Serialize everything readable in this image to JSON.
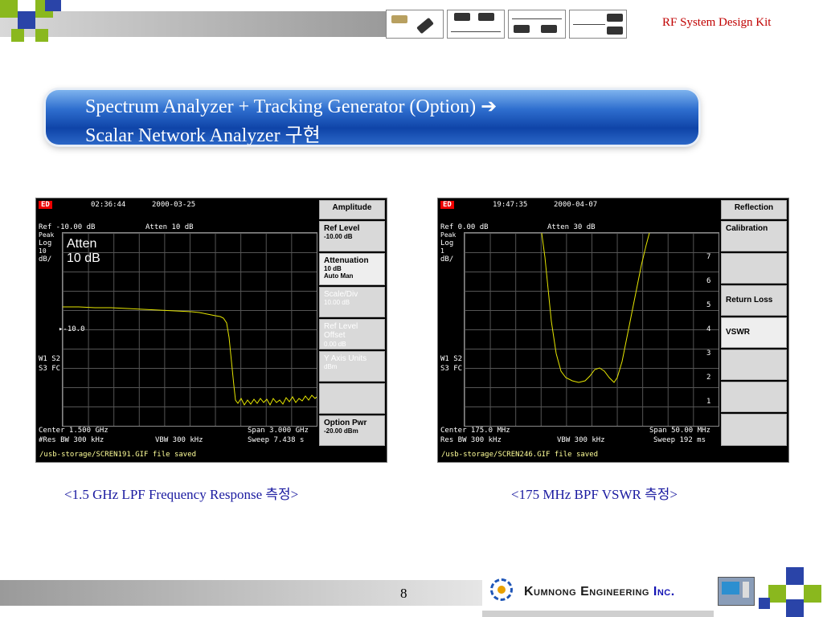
{
  "header": {
    "title": "RF System Design Kit"
  },
  "banner": {
    "line1": "Spectrum Analyzer +  Tracking Generator (Option) ➔",
    "line2": "Scalar Network Analyzer 구현"
  },
  "left_analyzer": {
    "badge": "ED",
    "time": "02:36:44",
    "date": "2000-03-25",
    "ref": "Ref -10.00 dB",
    "atten": "Atten  10 dB",
    "peak": "Peak",
    "log": "Log",
    "div_val": "10",
    "div_unit": "dB/",
    "overlay_line1": "Atten",
    "overlay_line2": "10 dB",
    "marker": "▸-10.0",
    "w1s2": "W1 S2",
    "s3fc": "S3 FC",
    "center": "Center  1.500 GHz",
    "span": "Span 3.000 GHz",
    "res_bw": "#Res BW 300 kHz",
    "vbw": "VBW  300 kHz",
    "sweep": "Sweep  7.438 s",
    "status": "/usb-storage/SCREN191.GIF file saved",
    "softkeys": [
      {
        "label": "Amplitude",
        "sub": ""
      },
      {
        "label": "Ref Level",
        "sub": "-10.00 dB"
      },
      {
        "label": "Attenuation",
        "sub": "10 dB",
        "sub2": "Auto    Man"
      },
      {
        "label": "Scale/Div",
        "sub": "10.00 dB"
      },
      {
        "label": "Ref Level Offset",
        "sub": "0.00 dB"
      },
      {
        "label": "Y Axis Units",
        "sub": "dBm"
      },
      {
        "label": "",
        "sub": ""
      },
      {
        "label": "Option Pwr",
        "sub": "-20.00 dBm"
      }
    ]
  },
  "right_analyzer": {
    "badge": "ED",
    "time": "19:47:35",
    "date": "2000-04-07",
    "ref": "Ref 0.00 dB",
    "atten": "Atten  30 dB",
    "peak": "Peak",
    "log": "Log",
    "div_val": "1",
    "div_unit": "dB/",
    "w1s2": "W1 S2",
    "s3fc": "S3 FC",
    "center": "Center  175.0 MHz",
    "span": "Span 50.00 MHz",
    "res_bw": "Res BW  300 kHz",
    "vbw": "VBW  300 kHz",
    "sweep": "Sweep  192 ms",
    "status": "/usb-storage/SCREN246.GIF file saved",
    "vswr_scale": [
      "7",
      "6",
      "5",
      "4",
      "3",
      "2",
      "1"
    ],
    "softkeys": [
      {
        "label": "Reflection"
      },
      {
        "label": "Calibration"
      },
      {
        "label": ""
      },
      {
        "label": "Return Loss"
      },
      {
        "label": "VSWR"
      },
      {
        "label": ""
      },
      {
        "label": ""
      },
      {
        "label": ""
      }
    ]
  },
  "captions": {
    "left": "<1.5 GHz LPF Frequency Response 측정>",
    "right": "<175 MHz BPF VSWR 측정>"
  },
  "footer": {
    "page": "8",
    "company_name": "Kumnong Engineering",
    "company_suffix": "Inc."
  },
  "colors": {
    "trace": "#e6e600",
    "banner": "#1f56b8",
    "title_red": "#c00000",
    "caption_blue": "#1a1aa0",
    "accent_green": "#8ab81e",
    "accent_blue": "#2a44a8"
  }
}
